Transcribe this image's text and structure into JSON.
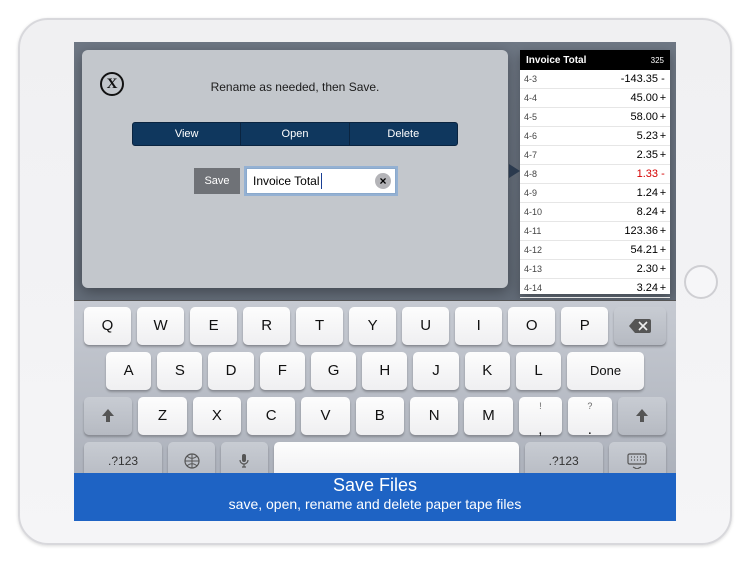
{
  "dialog": {
    "instruction": "Rename as needed, then Save.",
    "close_glyph": "X",
    "seg": {
      "view": "View",
      "open": "Open",
      "delete": "Delete"
    },
    "save_label": "Save",
    "filename": "Invoice Total",
    "clear_glyph": "×"
  },
  "tape": {
    "title": "Invoice Total",
    "count": "325",
    "rows": [
      {
        "label": "4-3",
        "value": "-143.35",
        "op": "-",
        "neg": false
      },
      {
        "label": "4-4",
        "value": "45.00",
        "op": "+",
        "neg": false
      },
      {
        "label": "4-5",
        "value": "58.00",
        "op": "+",
        "neg": false
      },
      {
        "label": "4-6",
        "value": "5.23",
        "op": "+",
        "neg": false
      },
      {
        "label": "4-7",
        "value": "2.35",
        "op": "+",
        "neg": false
      },
      {
        "label": "4-8",
        "value": "1.33",
        "op": "-",
        "neg": true
      },
      {
        "label": "4-9",
        "value": "1.24",
        "op": "+",
        "neg": false
      },
      {
        "label": "4-10",
        "value": "8.24",
        "op": "+",
        "neg": false
      },
      {
        "label": "4-11",
        "value": "123.36",
        "op": "+",
        "neg": false
      },
      {
        "label": "4-12",
        "value": "54.21",
        "op": "+",
        "neg": false
      },
      {
        "label": "4-13",
        "value": "2.30",
        "op": "+",
        "neg": false
      },
      {
        "label": "4-14",
        "value": "3.24",
        "op": "+",
        "neg": false
      }
    ]
  },
  "keyboard": {
    "row1": [
      "Q",
      "W",
      "E",
      "R",
      "T",
      "Y",
      "U",
      "I",
      "O",
      "P"
    ],
    "row2": [
      "A",
      "S",
      "D",
      "F",
      "G",
      "H",
      "J",
      "K",
      "L"
    ],
    "row3_keys": [
      "Z",
      "X",
      "C",
      "V",
      "B",
      "N",
      "M",
      ",",
      "."
    ],
    "done": "Done",
    "numsym": ".?123",
    "question": "?",
    "exclaim": "!"
  },
  "banner": {
    "title": "Save Files",
    "subtitle": "save, open, rename and delete paper tape files"
  }
}
